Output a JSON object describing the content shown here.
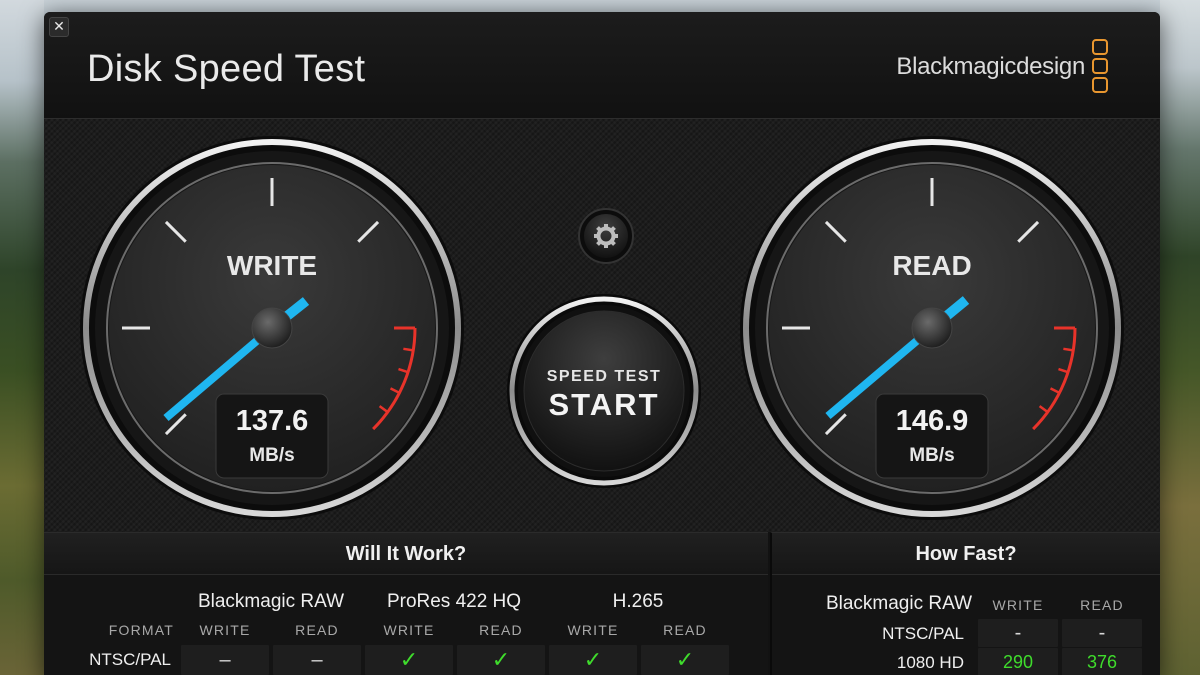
{
  "window": {
    "close": "✕"
  },
  "header": {
    "title": "Disk Speed Test",
    "brand": "Blackmagicdesign"
  },
  "gauges": {
    "write": {
      "label": "WRITE",
      "value": "137.6",
      "unit": "MB/s"
    },
    "read": {
      "label": "READ",
      "value": "146.9",
      "unit": "MB/s"
    }
  },
  "start_button": {
    "line1": "SPEED TEST",
    "line2": "START"
  },
  "settings": {
    "icon": "gear-icon"
  },
  "will_it_work": {
    "title": "Will It Work?",
    "format_label": "FORMAT",
    "codecs": [
      "Blackmagic RAW",
      "ProRes 422 HQ",
      "H.265"
    ],
    "write_label": "WRITE",
    "read_label": "READ",
    "rows": [
      {
        "format": "NTSC/PAL",
        "cells": [
          "–",
          "–",
          "✓",
          "✓",
          "✓",
          "✓"
        ]
      }
    ]
  },
  "how_fast": {
    "title": "How Fast?",
    "codec": "Blackmagic RAW",
    "write_label": "WRITE",
    "read_label": "READ",
    "rows": [
      {
        "format": "NTSC/PAL",
        "write": "-",
        "read": "-"
      },
      {
        "format": "1080 HD",
        "write": "290",
        "read": "376"
      }
    ]
  },
  "colors": {
    "needle": "#1fb6f0",
    "redline": "#e8332a",
    "accent": "#e8962f",
    "ok": "#3fdc2c"
  }
}
